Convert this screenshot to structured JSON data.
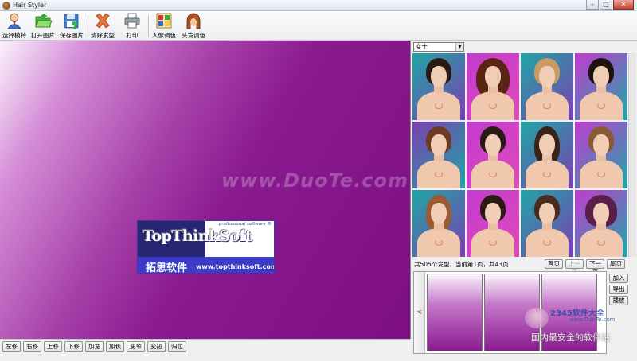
{
  "window": {
    "title": "Hair Styler",
    "controls": [
      "–",
      "□",
      "✕"
    ]
  },
  "toolbar": {
    "items": [
      {
        "label": "选择模特",
        "icon": "user-icon"
      },
      {
        "label": "打开图片",
        "icon": "open-folder-icon"
      },
      {
        "label": "保存图片",
        "icon": "save-icon"
      },
      {
        "label": "清除发型",
        "icon": "clear-x-icon"
      },
      {
        "label": "打印",
        "icon": "printer-icon"
      },
      {
        "label": "人像调色",
        "icon": "palette-icon"
      },
      {
        "label": "头发调色",
        "icon": "hair-color-icon"
      }
    ]
  },
  "canvas": {
    "logo": {
      "tagline": "professional software ®",
      "brand": "TopThinkSoft",
      "chinese": "拓思软件",
      "url": "www.topthinksoft.com"
    },
    "watermark": "www.DuoTe.com"
  },
  "controls": {
    "buttons": [
      "左移",
      "右移",
      "上移",
      "下移",
      "加宽",
      "加长",
      "变窄",
      "变短",
      "归位"
    ]
  },
  "panel": {
    "category": "女士",
    "pagination": {
      "info": "共505个发型，当前第1页，共43页",
      "first": "首页",
      "prev": "上一页",
      "next": "下一页",
      "last": "尾页"
    },
    "strip_arrow": "<",
    "actions": [
      "加入",
      "导出",
      "播放"
    ]
  },
  "site_watermark": {
    "site": "2345软件大全",
    "site_url": "www.DuoTe.com",
    "slogan": "国内最安全的软件站"
  },
  "colors": {
    "canvas_dark": "#7d0e84",
    "canvas_light": "#fbf2fb",
    "thumb_bg_teal": "#1fa6a6",
    "thumb_bg_magenta": "#c23bd0"
  }
}
